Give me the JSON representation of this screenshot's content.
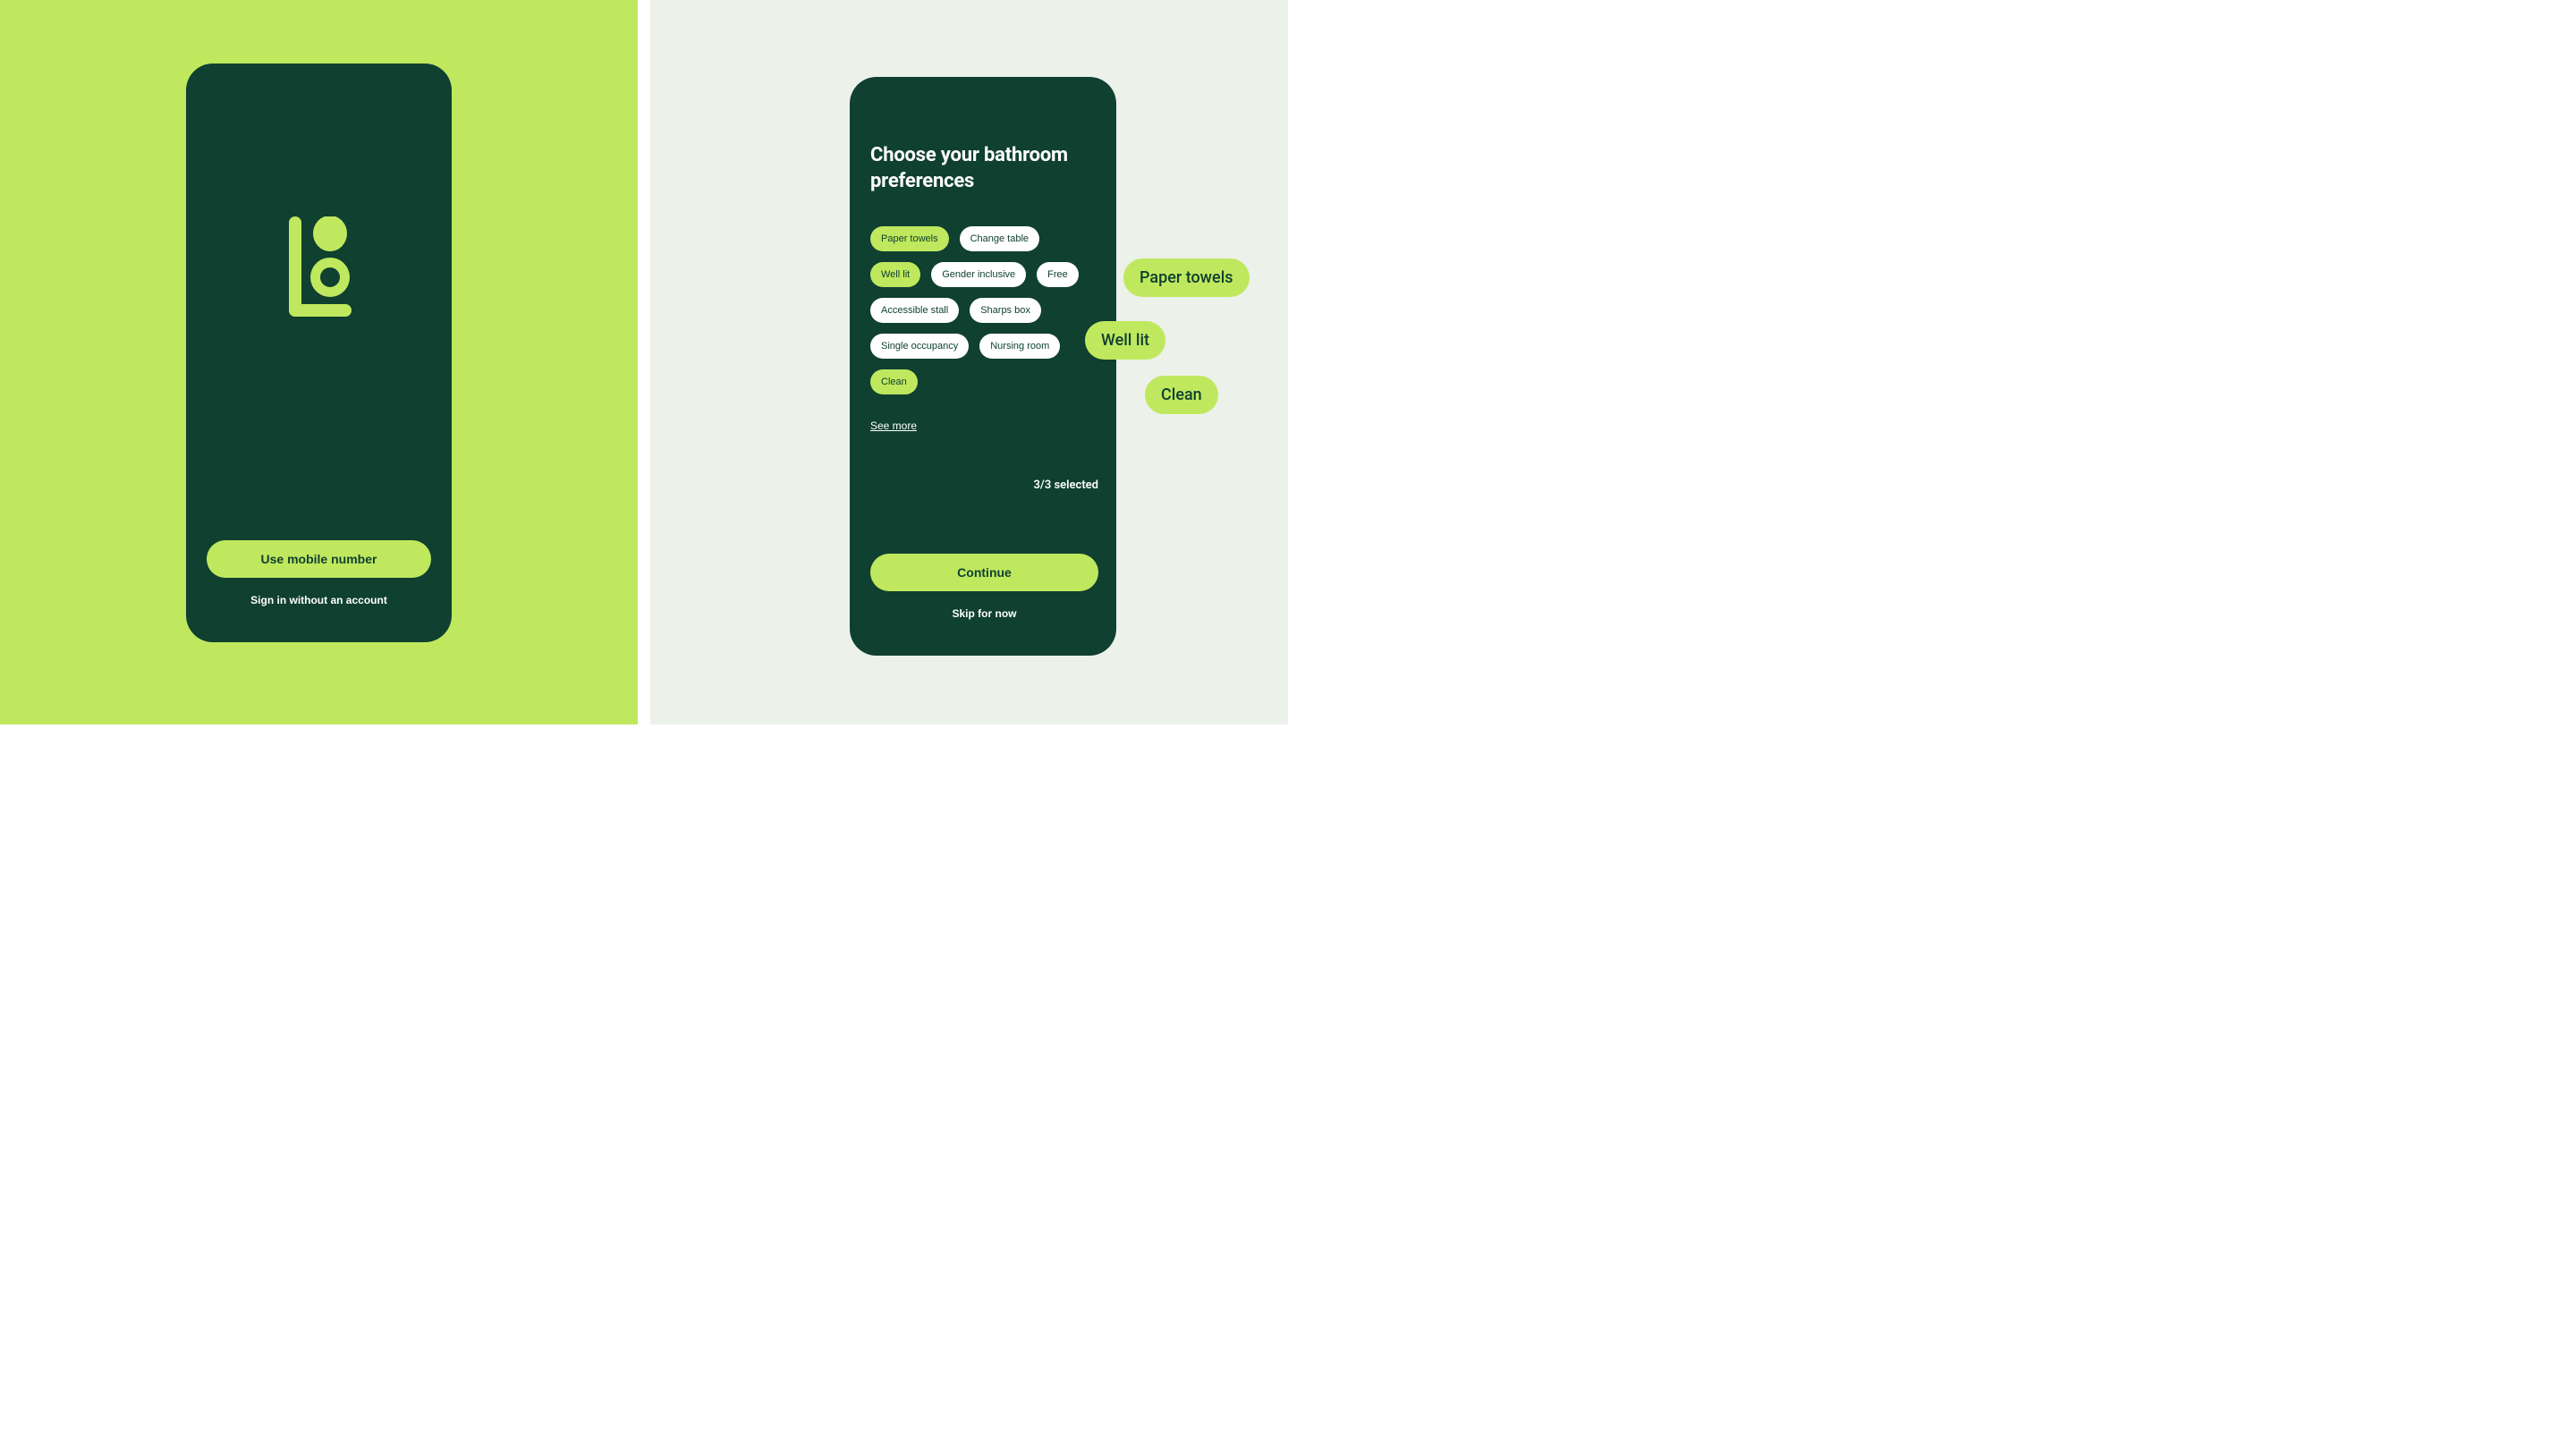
{
  "login": {
    "cta_primary": "Use mobile number",
    "cta_secondary": "Sign in without an account"
  },
  "prefs": {
    "title": "Choose your bathroom preferences",
    "chips": [
      {
        "label": "Paper towels",
        "selected": true
      },
      {
        "label": "Change table",
        "selected": false
      },
      {
        "label": "Well lit",
        "selected": true
      },
      {
        "label": "Gender inclusive",
        "selected": false
      },
      {
        "label": "Free",
        "selected": false
      },
      {
        "label": "Accessible stall",
        "selected": false
      },
      {
        "label": "Sharps box",
        "selected": false
      },
      {
        "label": "Single occupancy",
        "selected": false
      },
      {
        "label": "Nursing room",
        "selected": false
      },
      {
        "label": "Clean",
        "selected": true
      }
    ],
    "see_more": "See more",
    "selected_count": "3/3 selected",
    "continue": "Continue",
    "skip": "Skip for now"
  },
  "callouts": [
    "Paper towels",
    "Well lit",
    "Clean"
  ]
}
